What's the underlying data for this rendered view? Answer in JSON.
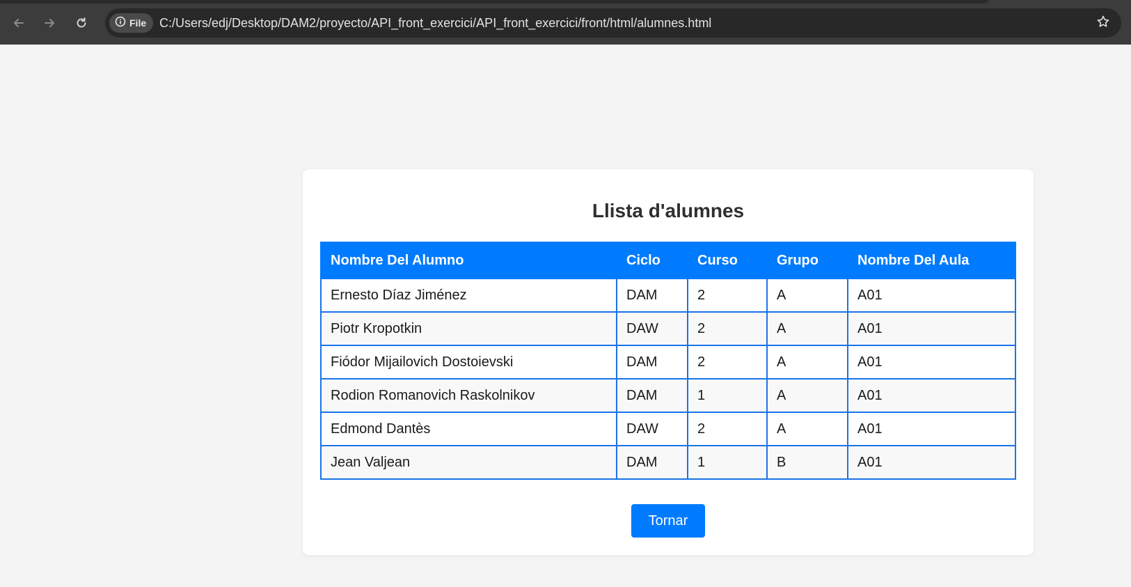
{
  "browser": {
    "site_chip_label": "File",
    "url": "C:/Users/edj/Desktop/DAM2/proyecto/API_front_exercici/API_front_exercici/front/html/alumnes.html",
    "icons": [
      "back-arrow-icon",
      "forward-arrow-icon",
      "reload-icon",
      "info-icon",
      "star-icon"
    ]
  },
  "page": {
    "title": "Llista d'alumnes",
    "back_button_label": "Tornar"
  },
  "table": {
    "headers": [
      "Nombre Del Alumno",
      "Ciclo",
      "Curso",
      "Grupo",
      "Nombre Del Aula"
    ],
    "rows": [
      [
        "Ernesto Díaz Jiménez",
        "DAM",
        "2",
        "A",
        "A01"
      ],
      [
        "Piotr Kropotkin",
        "DAW",
        "2",
        "A",
        "A01"
      ],
      [
        "Fiódor Mijailovich Dostoievski",
        "DAM",
        "2",
        "A",
        "A01"
      ],
      [
        "Rodion Romanovich Raskolnikov",
        "DAM",
        "1",
        "A",
        "A01"
      ],
      [
        "Edmond Dantès",
        "DAW",
        "2",
        "A",
        "A01"
      ],
      [
        "Jean Valjean",
        "DAM",
        "1",
        "B",
        "A01"
      ]
    ]
  },
  "colors": {
    "accent": "#007bff",
    "table_border": "#1a73e8",
    "page_background": "#f4f4f4",
    "browser_toolbar": "#3c3c3c"
  }
}
